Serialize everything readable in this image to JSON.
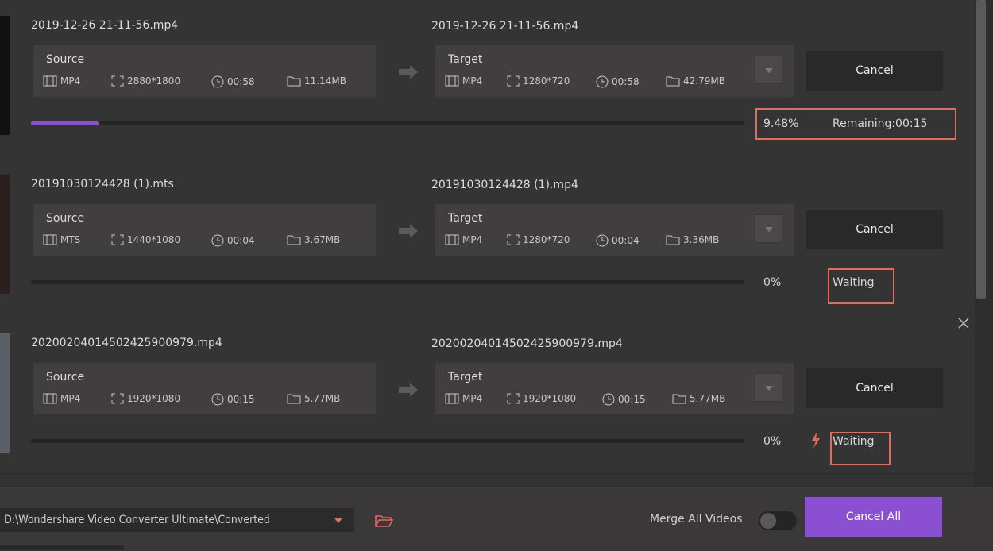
{
  "colors": {
    "accent": "#8b4fd1",
    "highlight": "#e8695c",
    "background": "#353434"
  },
  "items": [
    {
      "source_name": "2019-12-26 21-11-56.mp4",
      "target_name": "2019-12-26 21-11-56.mp4",
      "source": {
        "label": "Source",
        "format": "MP4",
        "resolution": "2880*1800",
        "duration": "00:58",
        "size": "11.14MB"
      },
      "target": {
        "label": "Target",
        "format": "MP4",
        "resolution": "1280*720",
        "duration": "00:58",
        "size": "42.79MB"
      },
      "cancel_label": "Cancel",
      "progress": 0.0948,
      "percent_text": "9.48%",
      "status_text": "Remaining:00:15"
    },
    {
      "source_name": "20191030124428 (1).mts",
      "target_name": "20191030124428 (1).mp4",
      "source": {
        "label": "Source",
        "format": "MTS",
        "resolution": "1440*1080",
        "duration": "00:04",
        "size": "3.67MB"
      },
      "target": {
        "label": "Target",
        "format": "MP4",
        "resolution": "1280*720",
        "duration": "00:04",
        "size": "3.36MB"
      },
      "cancel_label": "Cancel",
      "progress": 0,
      "percent_text": "0%",
      "status_text": "Waiting"
    },
    {
      "source_name": "20200204014502425900979.mp4",
      "target_name": "20200204014502425900979.mp4",
      "source": {
        "label": "Source",
        "format": "MP4",
        "resolution": "1920*1080",
        "duration": "00:15",
        "size": "5.77MB"
      },
      "target": {
        "label": "Target",
        "format": "MP4",
        "resolution": "1920*1080",
        "duration": "00:15",
        "size": "5.77MB"
      },
      "cancel_label": "Cancel",
      "progress": 0,
      "percent_text": "0%",
      "status_text": "Waiting"
    }
  ],
  "footer": {
    "output_path": "D:\\Wondershare Video Converter Ultimate\\Converted",
    "merge_label": "Merge All Videos",
    "merge_enabled": false,
    "cancel_all_label": "Cancel All"
  },
  "icons": {
    "format": "film-icon",
    "resolution": "resize-icon",
    "duration": "clock-icon",
    "size": "folder-icon",
    "arrow": "arrow-right-icon",
    "close": "close-icon",
    "bolt": "bolt-icon",
    "open_folder": "open-folder-icon"
  }
}
